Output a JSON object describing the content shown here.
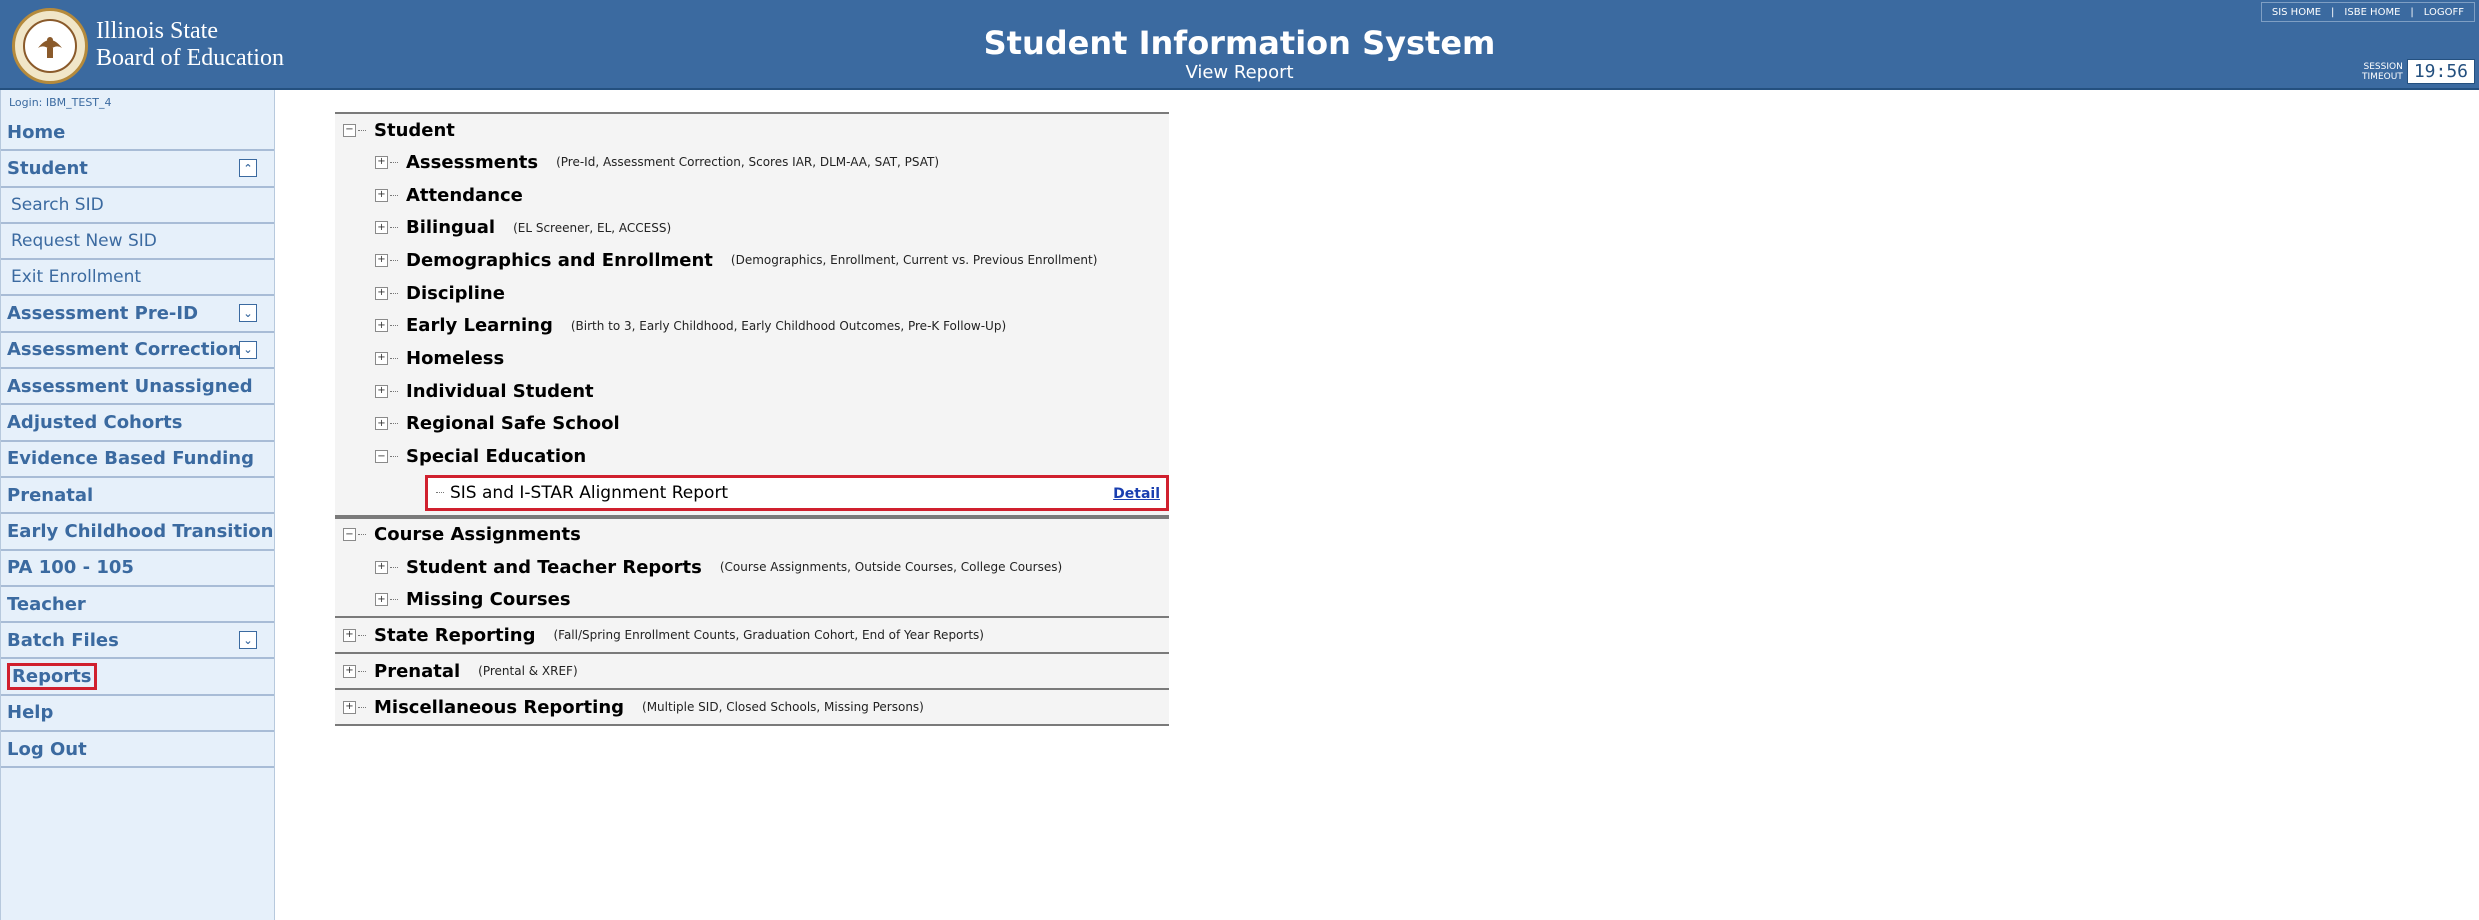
{
  "header": {
    "org_line1": "Illinois State",
    "org_line2": "Board of Education",
    "title": "Student Information System",
    "subtitle": "View Report",
    "links": [
      "SIS HOME",
      "ISBE HOME",
      "LOGOFF"
    ],
    "session_label_1": "SESSION",
    "session_label_2": "TIMEOUT",
    "session_time": "19:56"
  },
  "sidebar": {
    "login": "Login: IBM_TEST_4",
    "items": [
      {
        "label": "Home"
      },
      {
        "label": "Student"
      },
      {
        "label": "Search SID"
      },
      {
        "label": "Request New SID"
      },
      {
        "label": "Exit Enrollment"
      },
      {
        "label": "Assessment Pre-ID"
      },
      {
        "label": "Assessment Correction"
      },
      {
        "label": "Assessment Unassigned"
      },
      {
        "label": "Adjusted Cohorts"
      },
      {
        "label": "Evidence Based Funding"
      },
      {
        "label": "Prenatal"
      },
      {
        "label": "Early Childhood Transition"
      },
      {
        "label": "PA 100 - 105"
      },
      {
        "label": "Teacher"
      },
      {
        "label": "Batch Files"
      },
      {
        "label": "Reports"
      },
      {
        "label": "Help"
      },
      {
        "label": "Log Out"
      }
    ]
  },
  "tree": {
    "student": {
      "label": "Student",
      "children": [
        {
          "label": "Assessments",
          "desc": "(Pre-Id, Assessment Correction, Scores IAR, DLM-AA, SAT, PSAT)"
        },
        {
          "label": "Attendance",
          "desc": ""
        },
        {
          "label": "Bilingual",
          "desc": "(EL Screener, EL, ACCESS)"
        },
        {
          "label": "Demographics and Enrollment",
          "desc": "(Demographics, Enrollment, Current vs. Previous Enrollment)"
        },
        {
          "label": "Discipline",
          "desc": ""
        },
        {
          "label": "Early Learning",
          "desc": "(Birth to 3, Early Childhood, Early Childhood Outcomes, Pre-K Follow-Up)"
        },
        {
          "label": "Homeless",
          "desc": ""
        },
        {
          "label": "Individual Student",
          "desc": ""
        },
        {
          "label": "Regional Safe School",
          "desc": ""
        },
        {
          "label": "Special Education",
          "desc": ""
        }
      ],
      "report": {
        "label": "SIS and I-STAR Alignment Report",
        "link": "Detail"
      }
    },
    "course": {
      "label": "Course Assignments",
      "children": [
        {
          "label": "Student and Teacher Reports",
          "desc": "(Course Assignments, Outside Courses, College Courses)"
        },
        {
          "label": "Missing Courses",
          "desc": ""
        }
      ]
    },
    "state": {
      "label": "State Reporting",
      "desc": "(Fall/Spring Enrollment Counts, Graduation Cohort, End of Year Reports)"
    },
    "prenatal": {
      "label": "Prenatal",
      "desc": "(Prental & XREF)"
    },
    "misc": {
      "label": "Miscellaneous Reporting",
      "desc": "(Multiple SID, Closed Schools, Missing Persons)"
    }
  }
}
